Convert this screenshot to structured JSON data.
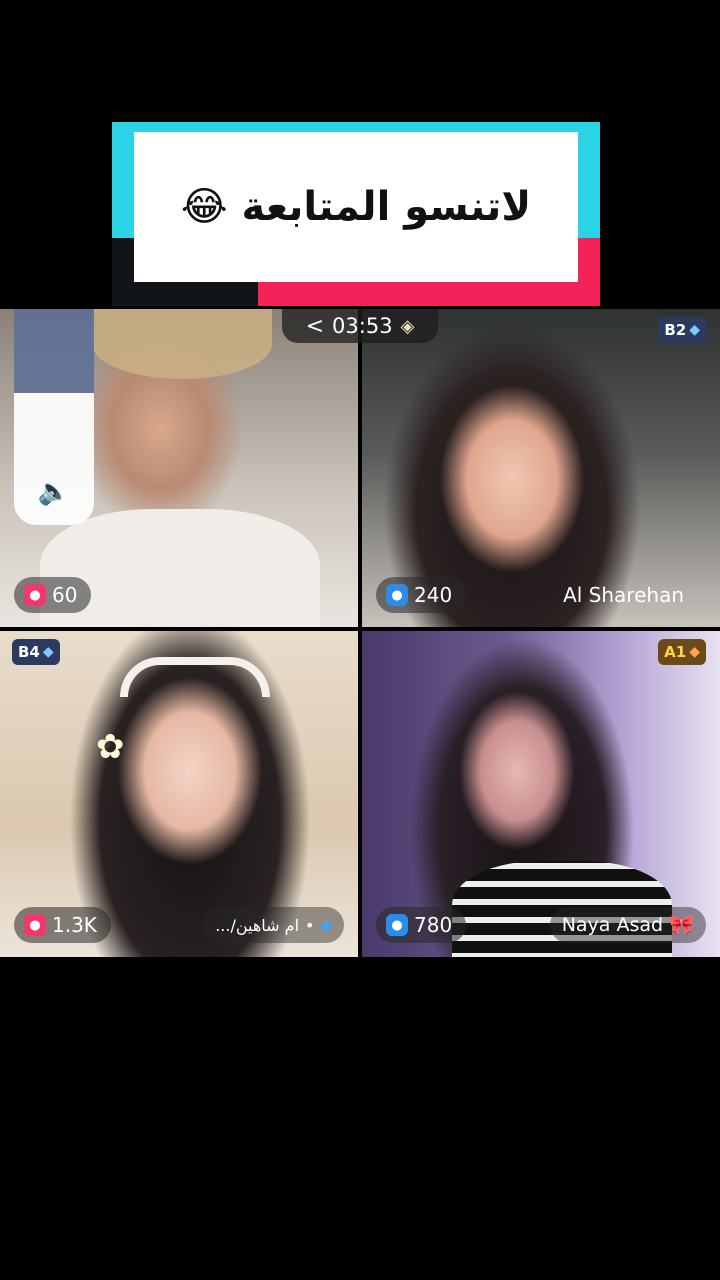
{
  "caption": {
    "text": "لاتنسو المتابعة 😂"
  },
  "timer": {
    "chevron": "<",
    "time": "03:53",
    "icon": "diamond-badge-icon"
  },
  "speaker": {
    "icon": "speaker-icon",
    "glyph": "🔈"
  },
  "tiles": [
    {
      "score": "60",
      "score_icon": "pink-gift-icon"
    },
    {
      "rank": "B2",
      "score": "240",
      "score_icon": "blue-gift-icon",
      "name": "Al Sharehan"
    },
    {
      "rank": "B4",
      "score": "1.3K",
      "score_icon": "pink-gift-icon",
      "name": "ام شاهين/...",
      "name_prefix": "•"
    },
    {
      "rank": "A1",
      "score": "780",
      "score_icon": "blue-gift-icon",
      "name": "Naya Asad"
    }
  ],
  "colors": {
    "cyan": "#2bd3e6",
    "pink": "#f3235a",
    "rank_b_bg": "#2b3a5e",
    "rank_a_bg": "#6b4a1a"
  }
}
